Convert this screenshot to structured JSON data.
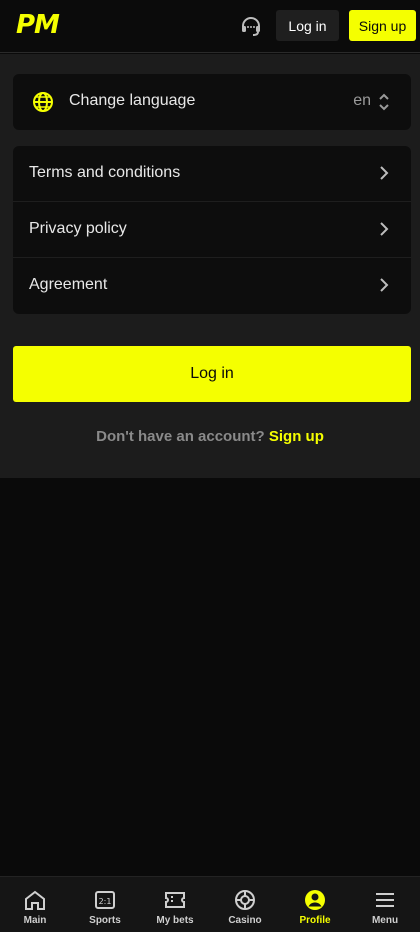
{
  "header": {
    "logo": "PM",
    "support_icon": "headset-icon",
    "login_label": "Log in",
    "signup_label": "Sign up"
  },
  "language": {
    "icon": "globe-icon",
    "label": "Change language",
    "value": "en"
  },
  "links": [
    {
      "label": "Terms and conditions"
    },
    {
      "label": "Privacy policy"
    },
    {
      "label": "Agreement"
    }
  ],
  "login_button": "Log in",
  "account": {
    "question": "Don't have an account?",
    "signup": "Sign up"
  },
  "bottom_nav": [
    {
      "label": "Main",
      "icon": "home-icon"
    },
    {
      "label": "Sports",
      "icon": "scoreboard-icon"
    },
    {
      "label": "My bets",
      "icon": "ticket-icon"
    },
    {
      "label": "Casino",
      "icon": "roulette-icon"
    },
    {
      "label": "Profile",
      "icon": "profile-icon",
      "active": true
    },
    {
      "label": "Menu",
      "icon": "menu-icon"
    }
  ],
  "colors": {
    "accent": "#f5ff00",
    "background": "#0a0a0a",
    "panel": "#1c1c1c",
    "card": "#0d0d0d"
  }
}
